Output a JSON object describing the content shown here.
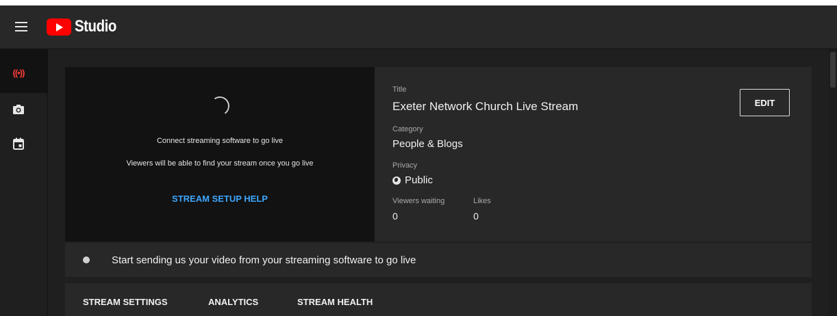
{
  "header": {
    "logo_text": "Studio"
  },
  "rail": {
    "items": [
      {
        "name": "live",
        "icon": "live-broadcast-icon",
        "glyph": "((•))"
      },
      {
        "name": "webcam",
        "icon": "camera-icon"
      },
      {
        "name": "schedule",
        "icon": "calendar-icon"
      }
    ]
  },
  "preview": {
    "connect_text": "Connect streaming software to go live",
    "viewers_text": "Viewers will be able to find your stream once you go live",
    "setup_help": "STREAM SETUP HELP"
  },
  "info": {
    "title_label": "Title",
    "title_value": "Exeter Network Church Live Stream",
    "category_label": "Category",
    "category_value": "People & Blogs",
    "privacy_label": "Privacy",
    "privacy_value": "Public",
    "viewers_waiting_label": "Viewers waiting",
    "viewers_waiting_value": "0",
    "likes_label": "Likes",
    "likes_value": "0",
    "edit_label": "EDIT"
  },
  "status": {
    "text": "Start sending us your video from your streaming software to go live"
  },
  "tabs": [
    {
      "label": "STREAM SETTINGS"
    },
    {
      "label": "ANALYTICS"
    },
    {
      "label": "STREAM HEALTH"
    }
  ],
  "colors": {
    "accent_link": "#3ea6ff",
    "live_red": "#ff3b3b",
    "brand_red": "#ff0000"
  }
}
